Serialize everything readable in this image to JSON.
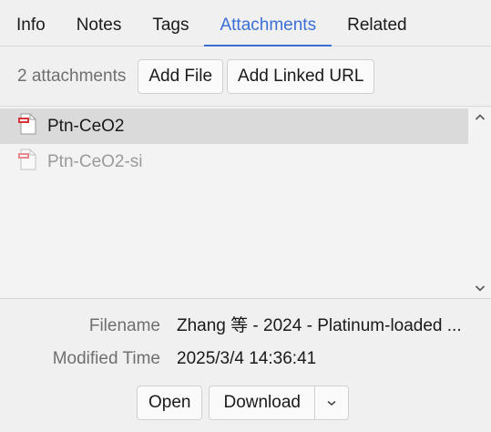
{
  "tabs": [
    {
      "label": "Info"
    },
    {
      "label": "Notes"
    },
    {
      "label": "Tags"
    },
    {
      "label": "Attachments",
      "active": true
    },
    {
      "label": "Related"
    }
  ],
  "toolbar": {
    "count_text": "2 attachments",
    "add_file_label": "Add File",
    "add_url_label": "Add Linked URL"
  },
  "attachments": [
    {
      "name": "Ptn-CeO2",
      "icon": "pdf-file-icon",
      "selected": true
    },
    {
      "name": "Ptn-CeO2-si",
      "icon": "pdf-file-icon",
      "selected": false
    }
  ],
  "details": {
    "filename_label": "Filename",
    "filename_value": "Zhang 等 - 2024 - Platinum-loaded ...",
    "modified_label": "Modified Time",
    "modified_value": "2025/3/4 14:36:41"
  },
  "actions": {
    "open_label": "Open",
    "download_label": "Download"
  },
  "colors": {
    "accent": "#3b6fd6",
    "pdf_red": "#d9343b"
  }
}
